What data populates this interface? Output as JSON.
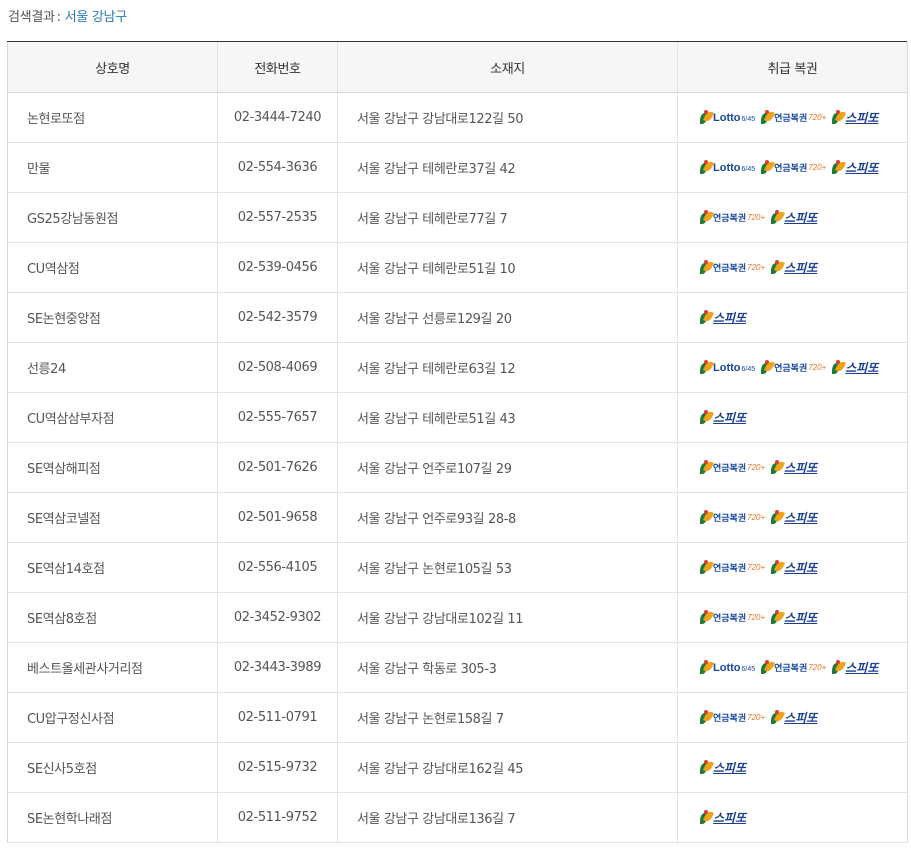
{
  "search_result": {
    "label": "검색결과",
    "separator": ":",
    "value": "서울 강남구"
  },
  "table": {
    "headers": {
      "name": "상호명",
      "phone": "전화번호",
      "address": "소재지",
      "lottery": "취급 복권"
    },
    "rows": [
      {
        "name": "논현로또점",
        "phone": "02-3444-7240",
        "address": "서울 강남구 강남대로122길 50",
        "lottery": [
          "lotto",
          "pension",
          "speetto"
        ]
      },
      {
        "name": "만물",
        "phone": "02-554-3636",
        "address": "서울 강남구 테헤란로37길 42",
        "lottery": [
          "lotto",
          "pension",
          "speetto"
        ]
      },
      {
        "name": "GS25강남동원점",
        "phone": "02-557-2535",
        "address": "서울 강남구 테헤란로77길 7",
        "lottery": [
          "pension",
          "speetto"
        ]
      },
      {
        "name": "CU역삼점",
        "phone": "02-539-0456",
        "address": "서울 강남구 테헤란로51길 10",
        "lottery": [
          "pension",
          "speetto"
        ]
      },
      {
        "name": "SE논현중앙점",
        "phone": "02-542-3579",
        "address": "서울 강남구 선릉로129길 20",
        "lottery": [
          "speetto"
        ]
      },
      {
        "name": "선릉24",
        "phone": "02-508-4069",
        "address": "서울 강남구 테헤란로63길 12",
        "lottery": [
          "lotto",
          "pension",
          "speetto"
        ]
      },
      {
        "name": "CU역삼삼부자점",
        "phone": "02-555-7657",
        "address": "서울 강남구 테헤란로51길 43",
        "lottery": [
          "speetto"
        ]
      },
      {
        "name": "SE역삼해피점",
        "phone": "02-501-7626",
        "address": "서울 강남구 언주로107길 29",
        "lottery": [
          "pension",
          "speetto"
        ]
      },
      {
        "name": "SE역삼코넬점",
        "phone": "02-501-9658",
        "address": "서울 강남구 언주로93길 28-8",
        "lottery": [
          "pension",
          "speetto"
        ]
      },
      {
        "name": "SE역삼14호점",
        "phone": "02-556-4105",
        "address": "서울 강남구 논현로105길 53",
        "lottery": [
          "pension",
          "speetto"
        ]
      },
      {
        "name": "SE역삼8호점",
        "phone": "02-3452-9302",
        "address": "서울 강남구 강남대로102길 11",
        "lottery": [
          "pension",
          "speetto"
        ]
      },
      {
        "name": "베스트올세관사거리점",
        "phone": "02-3443-3989",
        "address": "서울 강남구 학동로 305-3",
        "lottery": [
          "lotto",
          "pension",
          "speetto"
        ]
      },
      {
        "name": "CU압구정신사점",
        "phone": "02-511-0791",
        "address": "서울 강남구 논현로158길 7",
        "lottery": [
          "pension",
          "speetto"
        ]
      },
      {
        "name": "SE신사5호점",
        "phone": "02-515-9732",
        "address": "서울 강남구 강남대로162길 45",
        "lottery": [
          "speetto"
        ]
      },
      {
        "name": "SE논현학나래점",
        "phone": "02-511-9752",
        "address": "서울 강남구 강남대로136길 7",
        "lottery": [
          "speetto"
        ]
      }
    ]
  },
  "lottery_badges": {
    "lotto": {
      "word": "Lotto",
      "sub": "6/45",
      "icon": "lotto-logo-icon"
    },
    "pension": {
      "word": "연금복권",
      "sub": "720+",
      "icon": "pension-lottery-logo-icon"
    },
    "speetto": {
      "word": "스피또",
      "icon": "speetto-logo-icon"
    }
  },
  "colors": {
    "accent_link": "#2b7bb0",
    "header_bg": "#f6f6f6",
    "header_top_border": "#333333",
    "lotto_blue": "#17479e",
    "leaf_green": "#1d7b3a",
    "leaf_orange": "#f0a21a"
  }
}
